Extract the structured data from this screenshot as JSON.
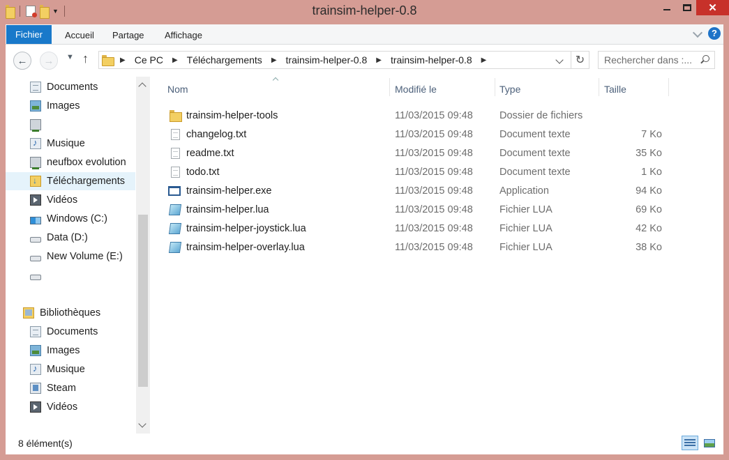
{
  "window": {
    "title": "trainsim-helper-0.8",
    "minimize_label": "",
    "close_label": "✕"
  },
  "ribbon": {
    "tabs": [
      {
        "label": "Fichier"
      },
      {
        "label": "Accueil"
      },
      {
        "label": "Partage"
      },
      {
        "label": "Affichage"
      }
    ],
    "help_label": "?"
  },
  "nav": {
    "back_glyph": "←",
    "forward_glyph": "→",
    "up_glyph": "↑",
    "breadcrumb": [
      "Ce PC",
      "Téléchargements",
      "trainsim-helper-0.8",
      "trainsim-helper-0.8"
    ],
    "search_placeholder": "Rechercher dans :...",
    "refresh_glyph": "↻"
  },
  "sidebar": {
    "items": [
      {
        "label": "Documents",
        "icon": "documents-icon"
      },
      {
        "label": "Images",
        "icon": "images-icon"
      },
      {
        "label": "",
        "icon": "network-drive-icon"
      },
      {
        "label": "Musique",
        "icon": "music-icon"
      },
      {
        "label": "neufbox evolution",
        "icon": "network-drive-icon"
      },
      {
        "label": "Téléchargements",
        "icon": "downloads-icon",
        "selected": true
      },
      {
        "label": "Vidéos",
        "icon": "videos-icon"
      },
      {
        "label": "Windows (C:)",
        "icon": "windows-drive-icon"
      },
      {
        "label": "Data (D:)",
        "icon": "drive-icon"
      },
      {
        "label": "New Volume (E:)",
        "icon": "drive-icon"
      },
      {
        "label": "",
        "icon": "drive-icon"
      }
    ],
    "libraries": {
      "label": "Bibliothèques",
      "items": [
        {
          "label": "Documents",
          "icon": "documents-icon"
        },
        {
          "label": "Images",
          "icon": "images-icon"
        },
        {
          "label": "Musique",
          "icon": "music-icon"
        },
        {
          "label": "Steam",
          "icon": "steam-icon"
        },
        {
          "label": "Vidéos",
          "icon": "videos-icon"
        }
      ]
    }
  },
  "filelist": {
    "columns": {
      "name": "Nom",
      "modified": "Modifié le",
      "type": "Type",
      "size": "Taille"
    },
    "rows": [
      {
        "name": "trainsim-helper-tools",
        "modified": "11/03/2015 09:48",
        "type": "Dossier de fichiers",
        "size": "",
        "icon": "folder-icon"
      },
      {
        "name": "changelog.txt",
        "modified": "11/03/2015 09:48",
        "type": "Document texte",
        "size": "7 Ko",
        "icon": "text-file-icon"
      },
      {
        "name": "readme.txt",
        "modified": "11/03/2015 09:48",
        "type": "Document texte",
        "size": "35 Ko",
        "icon": "text-file-icon"
      },
      {
        "name": "todo.txt",
        "modified": "11/03/2015 09:48",
        "type": "Document texte",
        "size": "1 Ko",
        "icon": "text-file-icon"
      },
      {
        "name": "trainsim-helper.exe",
        "modified": "11/03/2015 09:48",
        "type": "Application",
        "size": "94 Ko",
        "icon": "application-icon"
      },
      {
        "name": "trainsim-helper.lua",
        "modified": "11/03/2015 09:48",
        "type": "Fichier LUA",
        "size": "69 Ko",
        "icon": "lua-file-icon"
      },
      {
        "name": "trainsim-helper-joystick.lua",
        "modified": "11/03/2015 09:48",
        "type": "Fichier LUA",
        "size": "42 Ko",
        "icon": "lua-file-icon"
      },
      {
        "name": "trainsim-helper-overlay.lua",
        "modified": "11/03/2015 09:48",
        "type": "Fichier LUA",
        "size": "38 Ko",
        "icon": "lua-file-icon"
      }
    ]
  },
  "status": {
    "count_text": "8 élément(s)"
  }
}
